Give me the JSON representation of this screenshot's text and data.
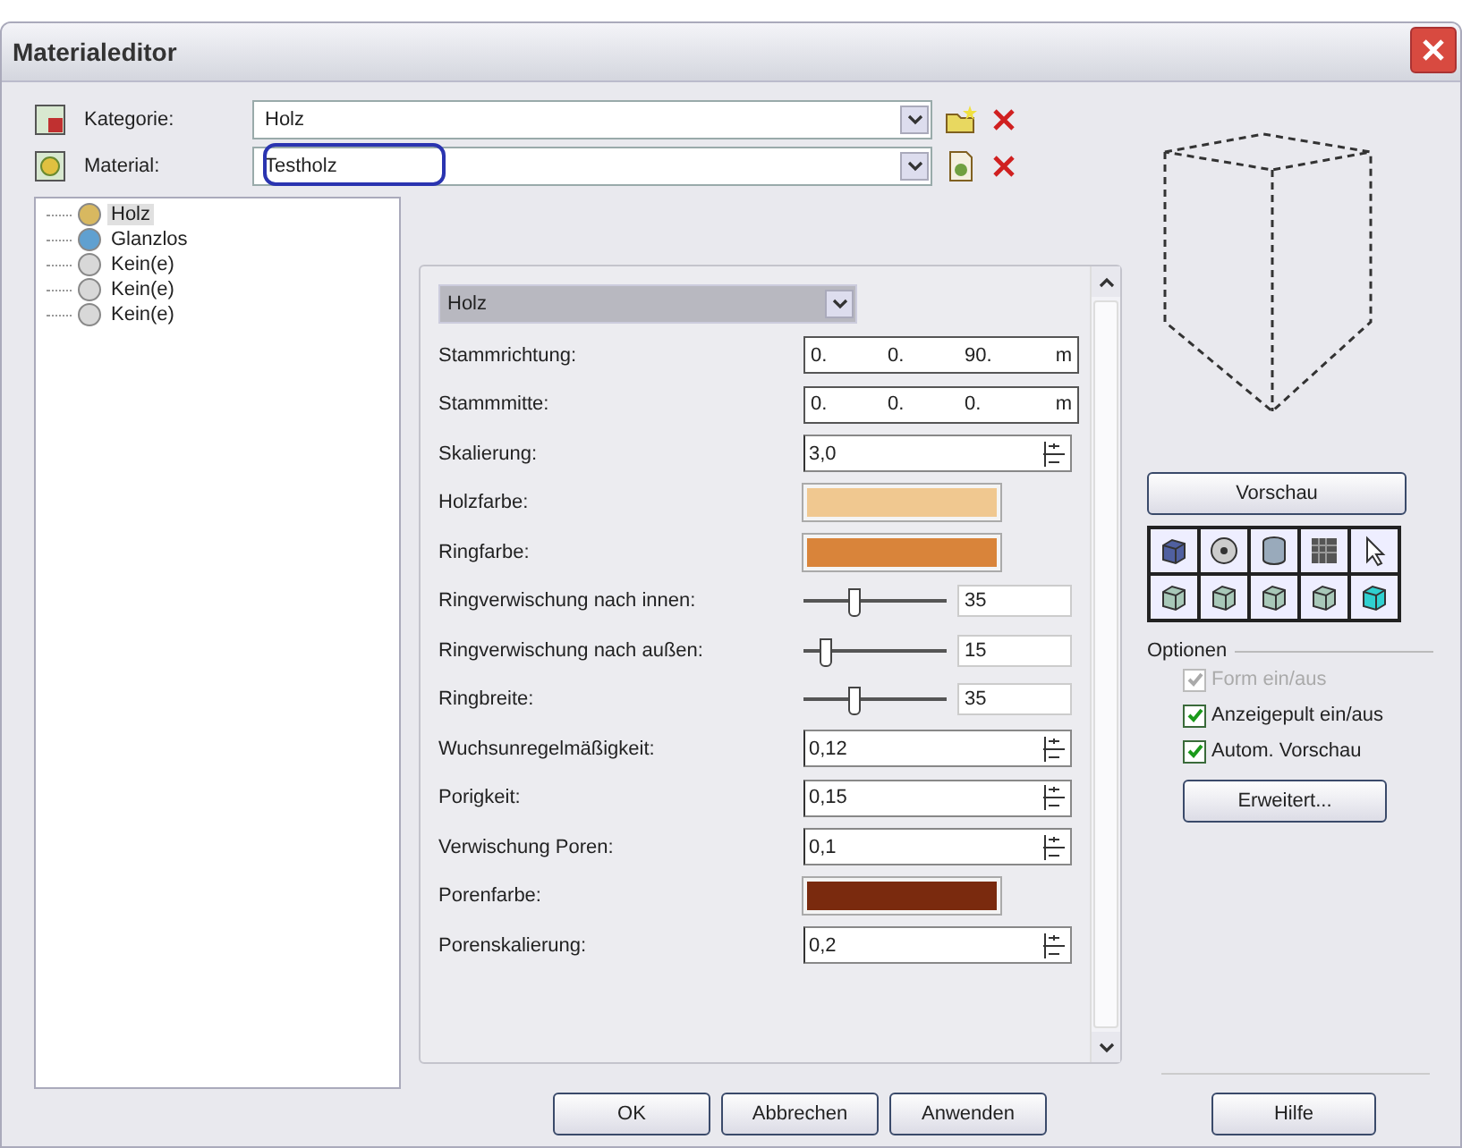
{
  "window": {
    "title": "Materialeditor"
  },
  "selectors": [
    {
      "label": "Kategorie:",
      "value": "Holz",
      "highlighted": false
    },
    {
      "label": "Material:",
      "value": "Testholz",
      "highlighted": true
    }
  ],
  "tree": [
    {
      "label": "Holz",
      "selected": true
    },
    {
      "label": "Glanzlos",
      "selected": false
    },
    {
      "label": "Kein(e)",
      "selected": false
    },
    {
      "label": "Kein(e)",
      "selected": false
    },
    {
      "label": "Kein(e)",
      "selected": false
    }
  ],
  "properties": {
    "type_dropdown": "Holz",
    "rows": [
      {
        "kind": "vector",
        "label": "Stammrichtung:",
        "values": [
          "0.",
          "0.",
          "90."
        ],
        "unit": "m"
      },
      {
        "kind": "vector",
        "label": "Stammmitte:",
        "values": [
          "0.",
          "0.",
          "0."
        ],
        "unit": "m"
      },
      {
        "kind": "spin",
        "label": "Skalierung:",
        "value": "3,0"
      },
      {
        "kind": "color",
        "label": "Holzfarbe:",
        "color": "#f0c890"
      },
      {
        "kind": "color",
        "label": "Ringfarbe:",
        "color": "#d9843a"
      },
      {
        "kind": "slider",
        "label": "Ringverwischung nach innen:",
        "level": 0.35,
        "value": "35"
      },
      {
        "kind": "slider",
        "label": "Ringverwischung nach außen:",
        "level": 0.15,
        "value": "15"
      },
      {
        "kind": "slider",
        "label": "Ringbreite:",
        "level": 0.35,
        "value": "35"
      },
      {
        "kind": "spin",
        "label": "Wuchsunregelmäßigkeit:",
        "value": "0,12"
      },
      {
        "kind": "spin",
        "label": "Porigkeit:",
        "value": "0,15"
      },
      {
        "kind": "spin",
        "label": "Verwischung Poren:",
        "value": "0,1"
      },
      {
        "kind": "color",
        "label": "Porenfarbe:",
        "color": "#7a2a0e"
      },
      {
        "kind": "spin",
        "label": "Porenskalierung:",
        "value": "0,2"
      }
    ]
  },
  "preview_button": "Vorschau",
  "options": {
    "title": "Optionen",
    "items": [
      {
        "label": "Form ein/aus",
        "checked": true,
        "disabled": true
      },
      {
        "label": "Anzeigepult ein/aus",
        "checked": true,
        "disabled": false
      },
      {
        "label": "Autom. Vorschau",
        "checked": true,
        "disabled": false
      }
    ],
    "advanced_button": "Erweitert..."
  },
  "buttons": [
    "OK",
    "Abbrechen",
    "Anwenden"
  ],
  "help_button": "Hilfe"
}
